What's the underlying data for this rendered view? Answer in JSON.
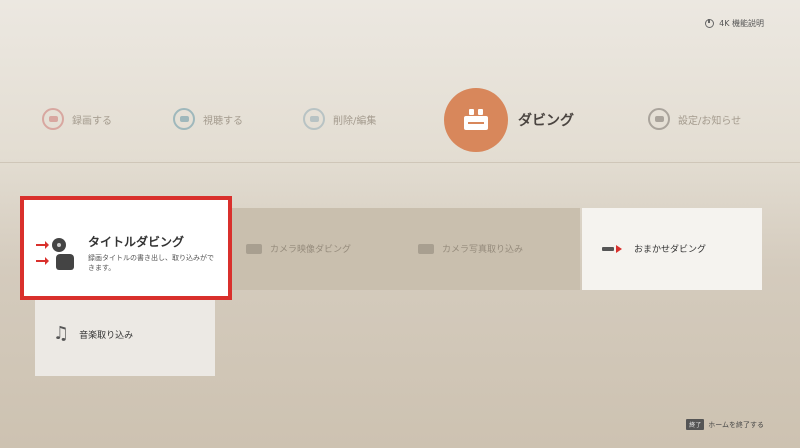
{
  "topbar": {
    "label": "4K 機能説明",
    "icon": "power-icon"
  },
  "menu": [
    {
      "label": "録画する",
      "icon": "record-icon",
      "color": "#d8a7a0"
    },
    {
      "label": "視聴する",
      "icon": "watch-icon",
      "color": "#9fb8bc"
    },
    {
      "label": "削除/編集",
      "icon": "edit-icon",
      "color": "#b8c3c4"
    },
    {
      "label": "ダビング",
      "icon": "dubbing-icon",
      "color": "#d8875b",
      "selected": true
    },
    {
      "label": "設定/お知らせ",
      "icon": "settings-icon",
      "color": "#aaa49c"
    }
  ],
  "tiles": {
    "title_dubbing": {
      "title": "タイトルダビング",
      "desc": "録画タイトルの書き出し、取り込みができます。"
    },
    "camera_dubbing": {
      "label": "カメラ映像ダビング"
    },
    "camera_import": {
      "label": "カメラ写真取り込み"
    },
    "omakase": {
      "label": "おまかせダビング"
    },
    "music": {
      "label": "音楽取り込み"
    }
  },
  "bottom_hint": {
    "key": "終了",
    "text": "ホームを終了する"
  },
  "accent_color": "#d9302c"
}
